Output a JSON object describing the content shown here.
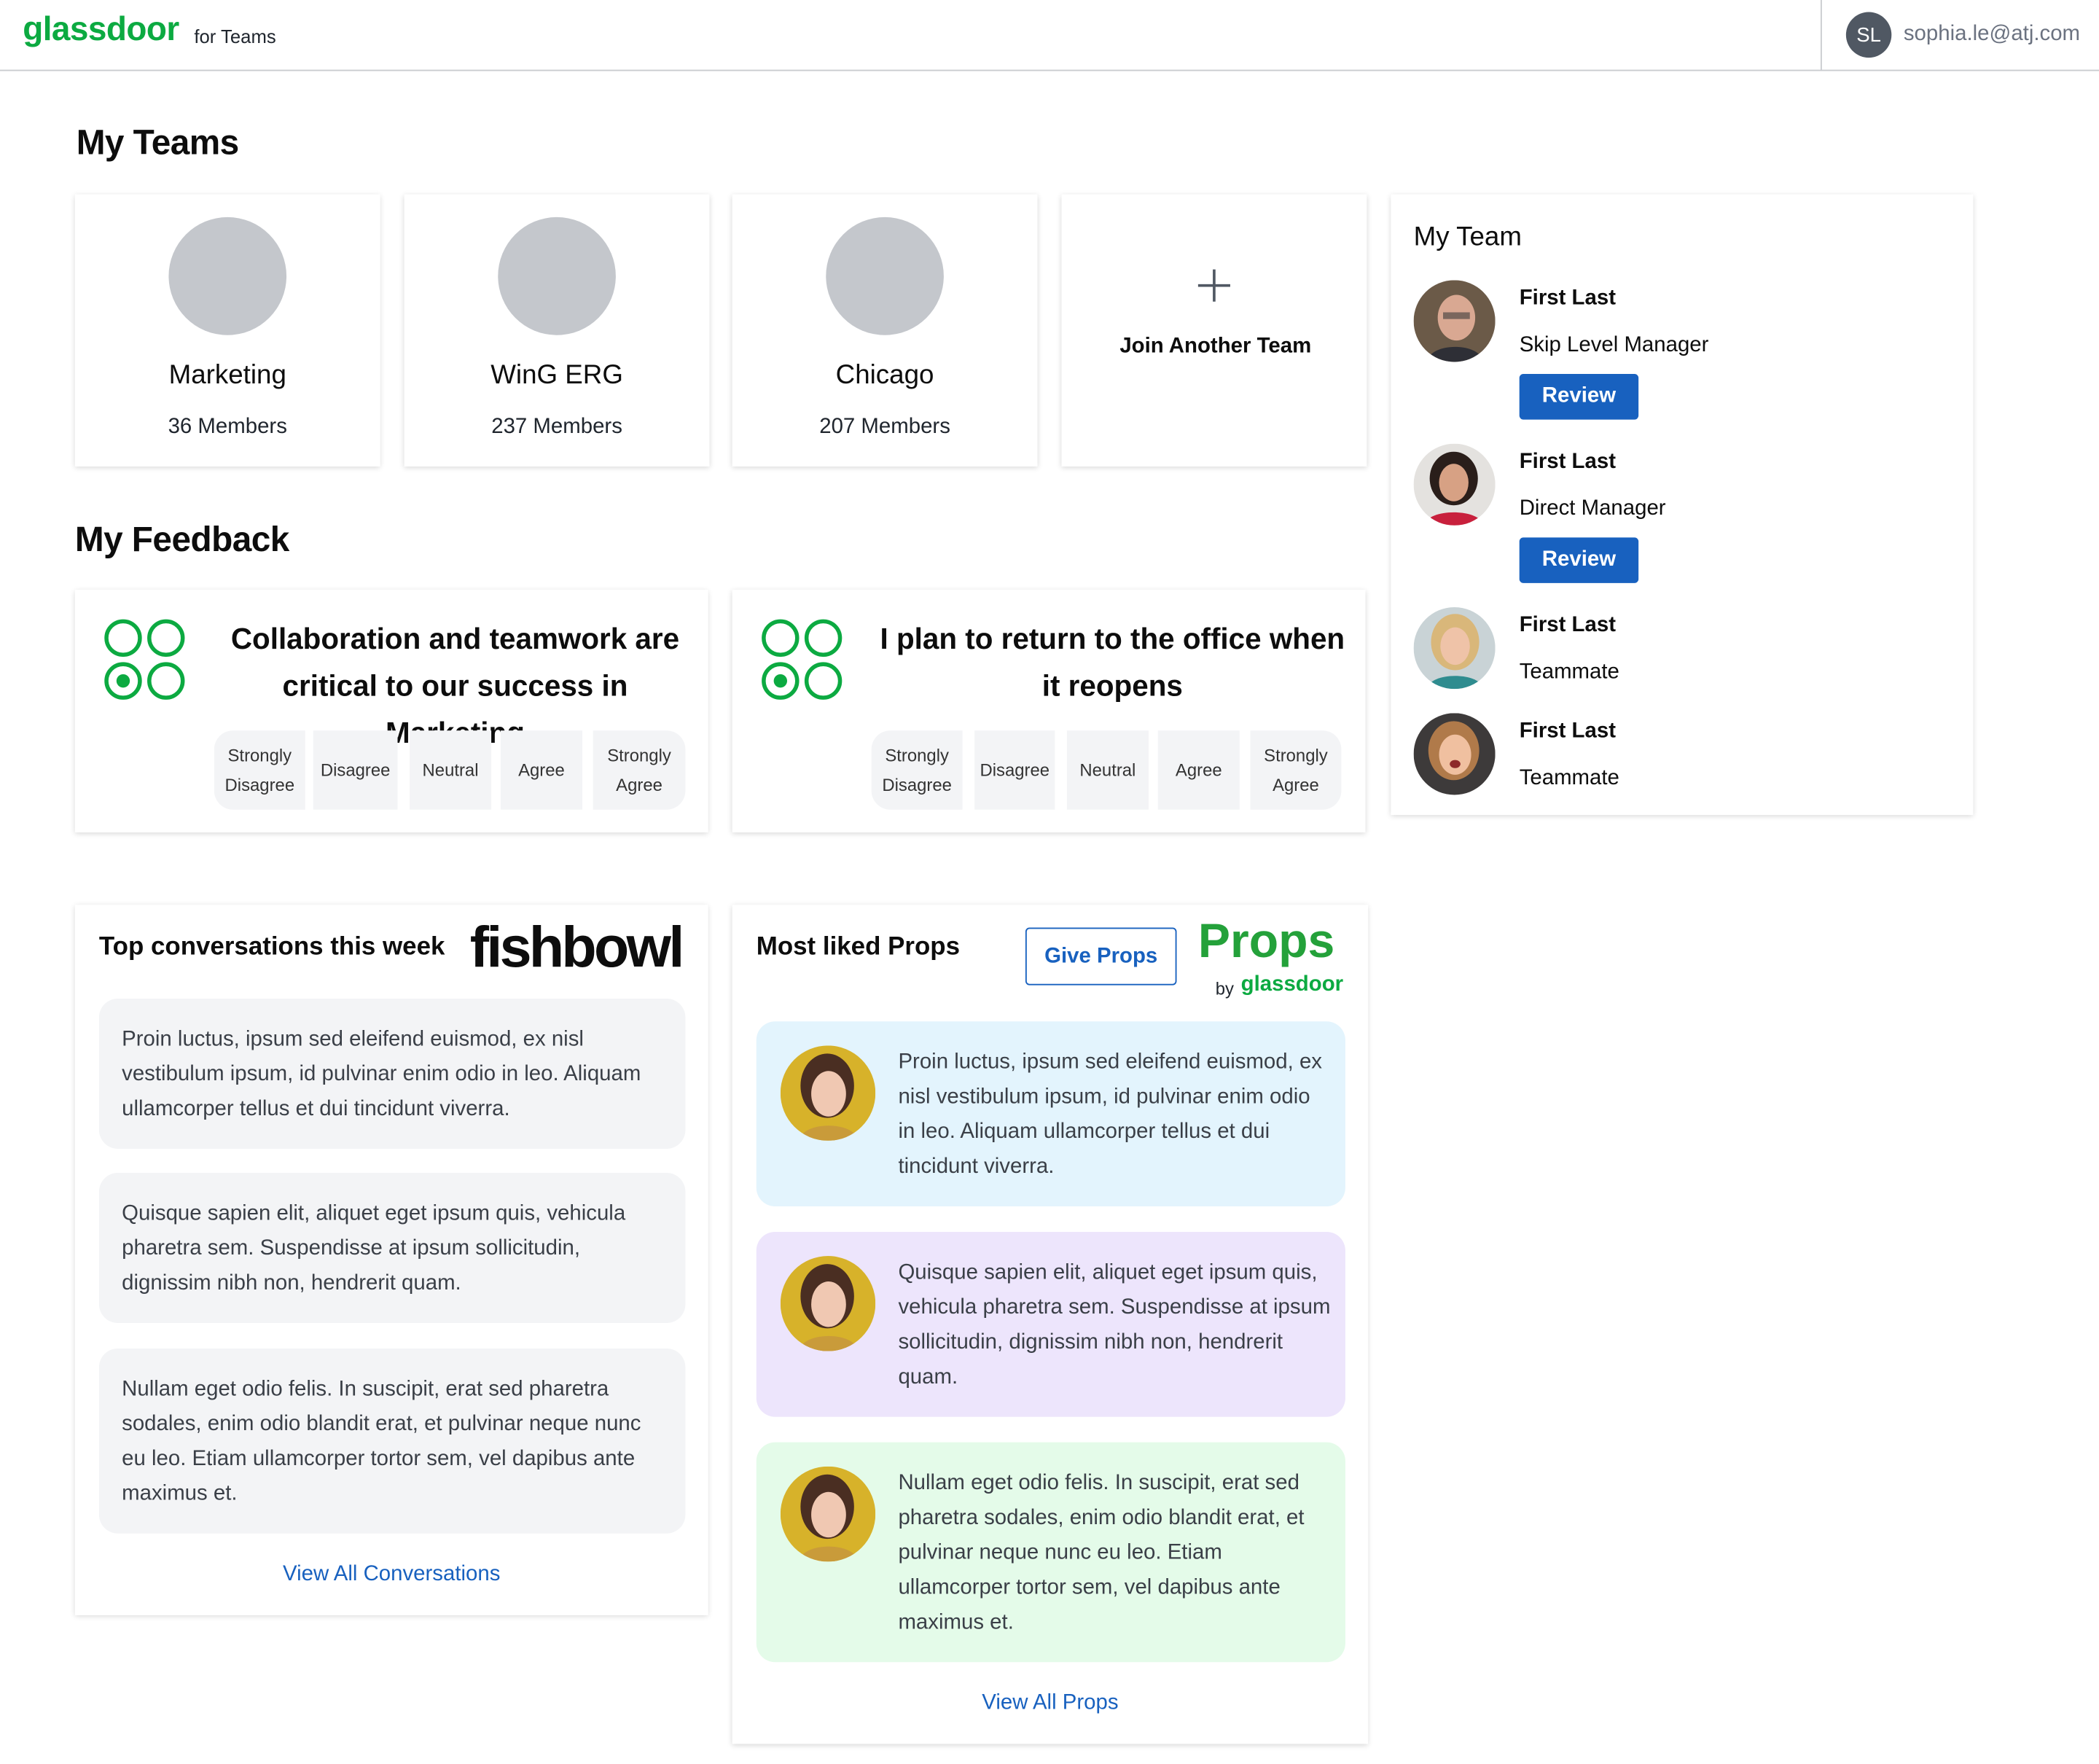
{
  "header": {
    "logo": "glassdoor",
    "product": "for Teams",
    "user_initials": "SL",
    "user_email": "sophia.le@atj.com"
  },
  "my_teams": {
    "title": "My Teams",
    "teams": [
      {
        "name": "Marketing",
        "members": "36 Members"
      },
      {
        "name": "WinG ERG",
        "members": "237 Members"
      },
      {
        "name": "Chicago",
        "members": "207 Members"
      }
    ],
    "join_label": "Join Another Team"
  },
  "my_feedback": {
    "title": "My Feedback",
    "questions": [
      {
        "text": "Collaboration and teamwork are critical to our success in Marketing",
        "options": [
          "Strongly Disagree",
          "Disagree",
          "Neutral",
          "Agree",
          "Strongly Agree"
        ]
      },
      {
        "text": "I plan to return to the office when it reopens",
        "options": [
          "Strongly Disagree",
          "Disagree",
          "Neutral",
          "Agree",
          "Strongly Agree"
        ]
      }
    ]
  },
  "my_team": {
    "title": "My Team",
    "review_label": "Review",
    "members": [
      {
        "name": "First Last",
        "role": "Skip Level Manager"
      },
      {
        "name": "First Last",
        "role": "Direct Manager"
      },
      {
        "name": "First Last",
        "role": "Teammate"
      },
      {
        "name": "First Last",
        "role": "Teammate"
      }
    ]
  },
  "conversations": {
    "title": "Top conversations this week",
    "brand": "fishbowl",
    "items": [
      "Proin luctus, ipsum sed eleifend euismod, ex nisl vestibulum ipsum, id pulvinar enim odio in leo. Aliquam ullamcorper tellus et dui tincidunt viverra.",
      "Quisque sapien elit, aliquet eget ipsum quis, vehicula pharetra sem. Suspendisse at ipsum sollicitudin, dignissim nibh non, hendrerit quam.",
      "Nullam eget odio felis. In suscipit, erat sed pharetra sodales, enim odio blandit erat, et pulvinar neque nunc eu leo. Etiam ullamcorper tortor sem, vel dapibus ante maximus et."
    ],
    "view_all": "View All Conversations"
  },
  "props": {
    "title": "Most liked Props",
    "give_button": "Give Props",
    "brand": "Props",
    "brand_by": "by",
    "brand_by_name": "glassdoor",
    "items": [
      {
        "text": "Proin luctus, ipsum sed eleifend euismod, ex nisl vestibulum ipsum, id pulvinar enim odio in leo. Aliquam ullamcorper tellus et dui tincidunt viverra.",
        "bg": "#e3f4fd"
      },
      {
        "text": "Quisque sapien elit, aliquet eget ipsum quis, vehicula pharetra sem. Suspendisse at ipsum sollicitudin, dignissim nibh non, hendrerit quam.",
        "bg": "#ede5fc"
      },
      {
        "text": "Nullam eget odio felis. In suscipit, erat sed pharetra sodales, enim odio blandit erat, et pulvinar neque nunc eu leo. Etiam ullamcorper tortor sem, vel dapibus ante maximus et.",
        "bg": "#e4fbe9"
      }
    ],
    "view_all": "View All Props"
  },
  "colors": {
    "brand_green": "#0caa41",
    "props_green": "#24a13a",
    "primary_blue": "#1861bf",
    "placeholder_gray": "#c4c7cc",
    "option_bg": "#f3f4f6"
  },
  "icons": [
    "plus-icon",
    "radio-scale-icon",
    "avatar-photo"
  ]
}
